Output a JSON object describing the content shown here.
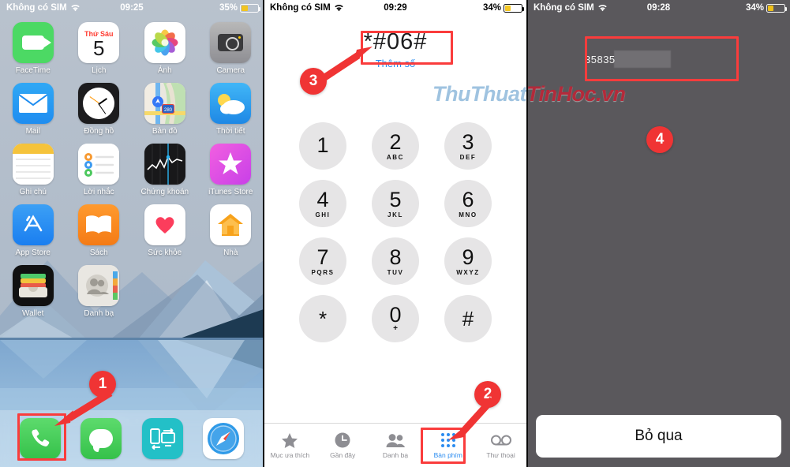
{
  "panels": {
    "home": {
      "status": {
        "carrier": "Không có SIM",
        "time": "09:25",
        "battery": "35%",
        "battery_pct": 35
      },
      "apps": [
        [
          {
            "label": "FaceTime",
            "icon": "facetime-icon"
          },
          {
            "label": "Lịch",
            "icon": "calendar-icon",
            "day": "Thứ Sáu",
            "date": "5"
          },
          {
            "label": "Ảnh",
            "icon": "photos-icon"
          },
          {
            "label": "Camera",
            "icon": "camera-icon"
          }
        ],
        [
          {
            "label": "Mail",
            "icon": "mail-icon"
          },
          {
            "label": "Đồng hồ",
            "icon": "clock-icon"
          },
          {
            "label": "Bản đồ",
            "icon": "maps-icon"
          },
          {
            "label": "Thời tiết",
            "icon": "weather-icon"
          }
        ],
        [
          {
            "label": "Ghi chú",
            "icon": "notes-icon"
          },
          {
            "label": "Lời nhắc",
            "icon": "reminders-icon"
          },
          {
            "label": "Chứng khoán",
            "icon": "stocks-icon"
          },
          {
            "label": "iTunes Store",
            "icon": "itunes-store-icon"
          }
        ],
        [
          {
            "label": "App Store",
            "icon": "app-store-icon"
          },
          {
            "label": "Sách",
            "icon": "books-icon"
          },
          {
            "label": "Sức khỏe",
            "icon": "health-icon"
          },
          {
            "label": "Nhà",
            "icon": "home-app-icon"
          }
        ],
        [
          {
            "label": "Wallet",
            "icon": "wallet-icon"
          },
          {
            "label": "Danh bạ",
            "icon": "contacts-icon"
          }
        ]
      ],
      "page_dots": 6,
      "active_dot": 1,
      "dock": [
        {
          "label": "Phone",
          "icon": "phone-icon"
        },
        {
          "label": "Messages",
          "icon": "messages-icon"
        },
        {
          "label": "FaceTime",
          "icon": "facetime-dock-icon"
        },
        {
          "label": "Safari",
          "icon": "safari-icon"
        }
      ]
    },
    "dialer": {
      "status": {
        "carrier": "Không có SIM",
        "time": "09:29",
        "battery": "34%",
        "battery_pct": 34
      },
      "number": "*#06#",
      "add_number_label": "Thêm số",
      "keys": [
        {
          "num": "1",
          "sub": ""
        },
        {
          "num": "2",
          "sub": "ABC"
        },
        {
          "num": "3",
          "sub": "DEF"
        },
        {
          "num": "4",
          "sub": "GHI"
        },
        {
          "num": "5",
          "sub": "JKL"
        },
        {
          "num": "6",
          "sub": "MNO"
        },
        {
          "num": "7",
          "sub": "PQRS"
        },
        {
          "num": "8",
          "sub": "TUV"
        },
        {
          "num": "9",
          "sub": "WXYZ"
        },
        {
          "num": "*",
          "sub": ""
        },
        {
          "num": "0",
          "sub": "+"
        },
        {
          "num": "#",
          "sub": ""
        }
      ],
      "tabs": [
        {
          "label": "Mục ưa thích",
          "icon": "star-icon",
          "active": false
        },
        {
          "label": "Gần đây",
          "icon": "clock-recent-icon",
          "active": false
        },
        {
          "label": "Danh bạ",
          "icon": "contacts-tab-icon",
          "active": false
        },
        {
          "label": "Bàn phím",
          "icon": "keypad-icon",
          "active": true
        },
        {
          "label": "Thư thoại",
          "icon": "voicemail-icon",
          "active": false
        }
      ]
    },
    "imei": {
      "status": {
        "carrier": "Không có SIM",
        "time": "09:28",
        "battery": "34%",
        "battery_pct": 34
      },
      "imei_visible": "35835",
      "skip_label": "Bỏ qua"
    }
  },
  "annotations": {
    "badges": [
      "1",
      "2",
      "3",
      "4"
    ]
  },
  "watermark": {
    "part_a": "ThuThuat",
    "part_b": "TinHoc.vn"
  },
  "colors": {
    "annotation_red": "#f03434",
    "accent_blue": "#2b8cf0",
    "call_green": "#32cd54",
    "imei_bg": "#5a585c"
  }
}
